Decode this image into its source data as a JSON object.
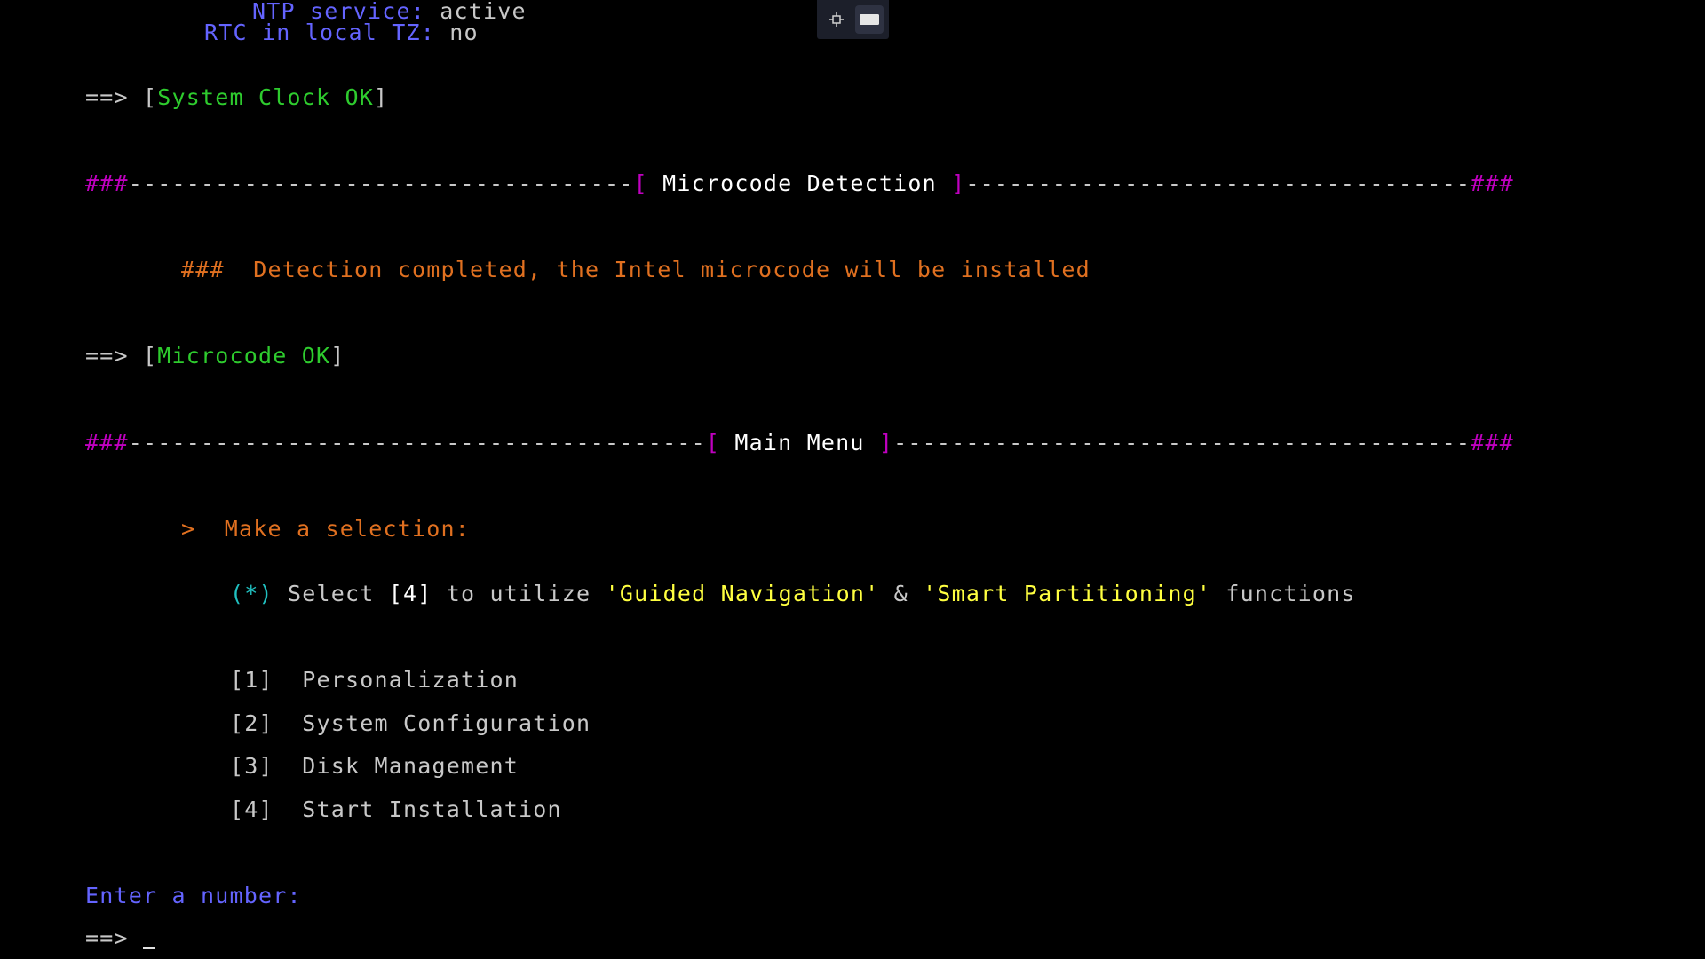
{
  "toolbar": {
    "buttons": [
      {
        "icon": "move-icon"
      },
      {
        "icon": "keyboard-icon"
      }
    ]
  },
  "clock": {
    "ntp_label": "NTP service:",
    "ntp_value": "active",
    "rtc_label": "RTC in local TZ:",
    "rtc_value": "no"
  },
  "system_clock_status": {
    "prefix": "==> [",
    "text": "System Clock OK",
    "suffix": "]"
  },
  "microcode_header": {
    "left_hash": "###",
    "left_dashes": "-----------------------------------",
    "left_bracket": "[",
    "title": " Microcode Detection ",
    "right_bracket": "]",
    "right_dashes": "-----------------------------------",
    "right_hash": "###"
  },
  "microcode_message": "###  Detection completed, the Intel microcode will be installed",
  "microcode_status": {
    "prefix": "==> [",
    "text": "Microcode OK",
    "suffix": "]"
  },
  "menu_header": {
    "left_hash": "###",
    "left_dashes": "----------------------------------------",
    "left_bracket": "[",
    "title": " Main Menu ",
    "right_bracket": "]",
    "right_dashes": "----------------------------------------",
    "right_hash": "###"
  },
  "menu": {
    "prompt_arrow": ">",
    "prompt_text": "Make a selection:",
    "hint": {
      "marker": "(*)",
      "select_word": " Select ",
      "key": "[4]",
      "mid": " to utilize ",
      "feature1": "'Guided Navigation'",
      "amp": " & ",
      "feature2": "'Smart Partitioning'",
      "tail": " functions"
    },
    "options": [
      {
        "key": "[1]",
        "label": "Personalization"
      },
      {
        "key": "[2]",
        "label": "System Configuration"
      },
      {
        "key": "[3]",
        "label": "Disk Management"
      },
      {
        "key": "[4]",
        "label": "Start Installation"
      }
    ]
  },
  "input": {
    "prompt": "Enter a number:",
    "arrow": "==> "
  },
  "colors": {
    "background": "#000000",
    "blue": "#6464ff",
    "green": "#2ecc2e",
    "magenta": "#c000c0",
    "orange": "#e07020",
    "yellow": "#ffff40",
    "cyan": "#20c0c0"
  }
}
